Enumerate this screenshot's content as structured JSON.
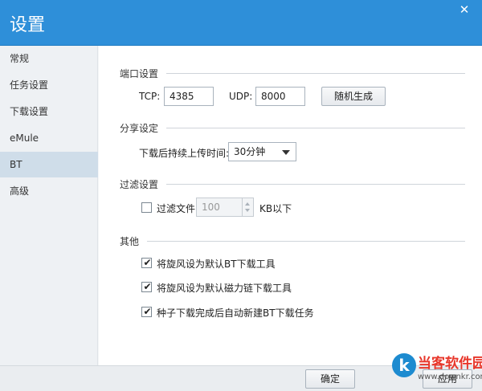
{
  "window": {
    "title": "设置",
    "close_glyph": "✕"
  },
  "sidebar": {
    "items": [
      {
        "label": "常规",
        "active": false
      },
      {
        "label": "任务设置",
        "active": false
      },
      {
        "label": "下载设置",
        "active": false
      },
      {
        "label": "eMule",
        "active": false
      },
      {
        "label": "BT",
        "active": true
      },
      {
        "label": "高级",
        "active": false
      }
    ]
  },
  "port": {
    "section_title": "端口设置",
    "tcp_label": "TCP:",
    "tcp_value": "4385",
    "udp_label": "UDP:",
    "udp_value": "8000",
    "random_button": "随机生成"
  },
  "share": {
    "section_title": "分享设定",
    "upload_label": "下载后持续上传时间:",
    "upload_value": "30分钟"
  },
  "filter": {
    "section_title": "过滤设置",
    "checkbox_label": "过滤文件",
    "checked": false,
    "value": "100",
    "unit": "KB以下"
  },
  "other": {
    "section_title": "其他",
    "options": [
      {
        "label": "将旋风设为默认BT下载工具",
        "checked": true
      },
      {
        "label": "将旋风设为默认磁力链下载工具",
        "checked": true
      },
      {
        "label": "种子下载完成后自动新建BT下载任务",
        "checked": true
      }
    ],
    "check_glyph": "✔"
  },
  "footer": {
    "ok_button": "确定",
    "apply_button": "应用"
  },
  "watermark": {
    "logo_letter": "k",
    "title": "当客软件园",
    "url": "www.downkr.com"
  }
}
